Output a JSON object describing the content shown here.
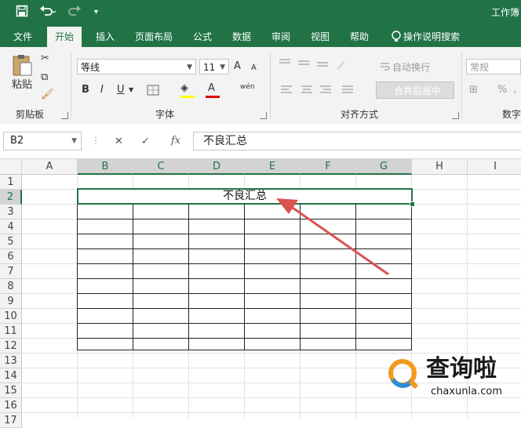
{
  "titlebar": {
    "title": "工作簿"
  },
  "tabs": [
    "文件",
    "开始",
    "插入",
    "页面布局",
    "公式",
    "数据",
    "审阅",
    "视图",
    "帮助"
  ],
  "tell_me": "操作说明搜索",
  "clipboard": {
    "paste": "粘贴",
    "group": "剪贴板"
  },
  "font": {
    "name": "等线",
    "size": "11",
    "group": "字体",
    "bold": "B",
    "italic": "I",
    "underline": "U",
    "grow": "A",
    "shrink": "A",
    "font_color": "A",
    "phonetic": "wén"
  },
  "alignment": {
    "wrap": "自动换行",
    "merge": "合并后居中",
    "group": "对齐方式"
  },
  "number": {
    "format": "常规",
    "percent": "%",
    "group": "数字"
  },
  "formula_bar": {
    "name_box": "B2",
    "fx": "fx",
    "content": "不良汇总"
  },
  "columns": [
    "A",
    "B",
    "C",
    "D",
    "E",
    "F",
    "G",
    "H",
    "I"
  ],
  "rows": [
    "1",
    "2",
    "3",
    "4",
    "5",
    "6",
    "7",
    "8",
    "9",
    "10",
    "11",
    "12",
    "13",
    "14",
    "15",
    "16",
    "17"
  ],
  "cells": {
    "B2": "不良汇总"
  },
  "watermark": {
    "brand": "查询啦",
    "url": "chaxunla.com"
  },
  "colors": {
    "excel_green": "#217346",
    "arrow": "#d9534f",
    "watermark_orange": "#f39a1e",
    "watermark_blue": "#2b8fd8"
  }
}
